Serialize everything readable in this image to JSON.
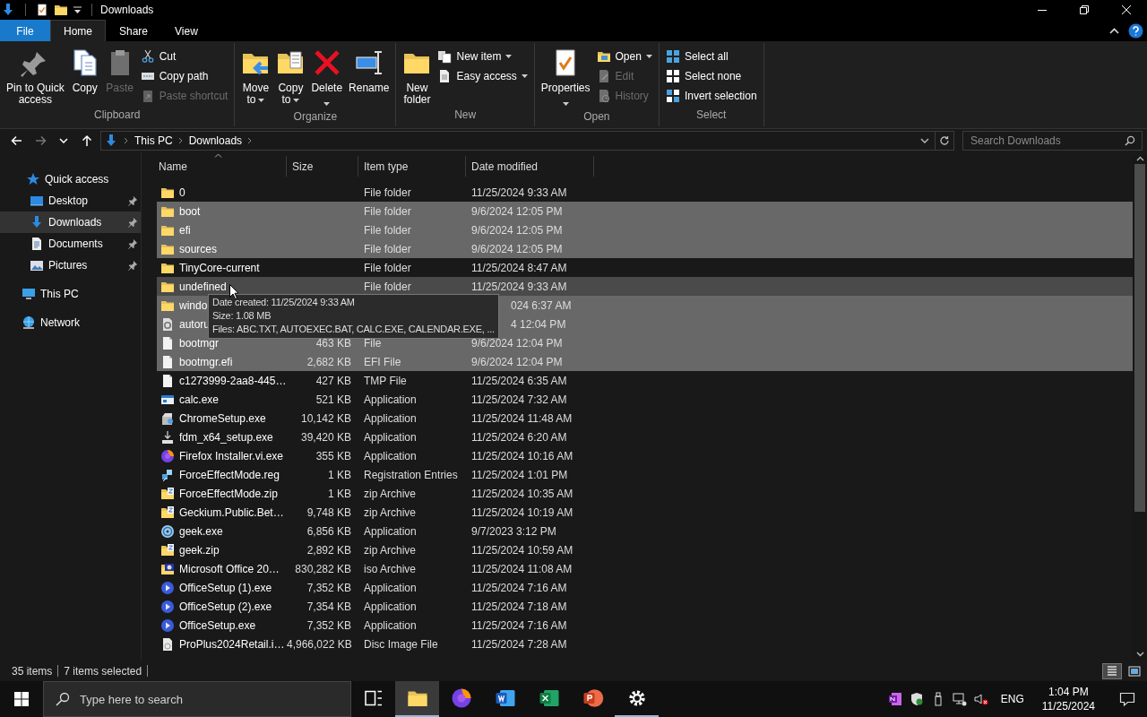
{
  "window": {
    "title": "Downloads"
  },
  "ribbon_tabs": [
    {
      "label": "File",
      "kind": "menu",
      "selected": false
    },
    {
      "label": "Home",
      "kind": "tab",
      "selected": true
    },
    {
      "label": "Share",
      "kind": "tab",
      "selected": false
    },
    {
      "label": "View",
      "kind": "tab",
      "selected": false
    }
  ],
  "ribbon": {
    "groups": [
      {
        "label": "Clipboard",
        "large": [
          {
            "lines": [
              "Pin to Quick",
              "access"
            ],
            "kind": "pin",
            "disabled": false,
            "dropdown": false
          },
          {
            "lines": [
              "Copy"
            ],
            "kind": "copy",
            "disabled": false,
            "dropdown": false
          },
          {
            "lines": [
              "Paste"
            ],
            "kind": "paste",
            "disabled": true,
            "dropdown": false
          }
        ],
        "small": [
          {
            "label": "Cut",
            "kind": "scissors",
            "disabled": false,
            "dropdown": false
          },
          {
            "label": "Copy path",
            "kind": "copypath",
            "disabled": false,
            "dropdown": false
          },
          {
            "label": "Paste shortcut",
            "kind": "pasteshortcut",
            "disabled": true,
            "dropdown": false
          }
        ]
      },
      {
        "label": "Organize",
        "large": [
          {
            "lines": [
              "Move",
              "to"
            ],
            "kind": "moveto",
            "disabled": false,
            "dropdown": true
          },
          {
            "lines": [
              "Copy",
              "to"
            ],
            "kind": "copyto",
            "disabled": false,
            "dropdown": true
          },
          {
            "lines": [
              "Delete"
            ],
            "kind": "delete",
            "disabled": false,
            "dropdown": true
          },
          {
            "lines": [
              "Rename"
            ],
            "kind": "rename",
            "disabled": false,
            "dropdown": false
          }
        ]
      },
      {
        "label": "New",
        "large": [
          {
            "lines": [
              "New",
              "folder"
            ],
            "kind": "folder",
            "disabled": false,
            "dropdown": false
          }
        ],
        "small": [
          {
            "label": "New item",
            "kind": "newitem",
            "disabled": false,
            "dropdown": true
          },
          {
            "label": "Easy access",
            "kind": "easyaccess",
            "disabled": false,
            "dropdown": true
          }
        ]
      },
      {
        "label": "Open",
        "large": [
          {
            "lines": [
              "Properties"
            ],
            "kind": "properties",
            "disabled": false,
            "dropdown": true
          }
        ],
        "small": [
          {
            "label": "Open",
            "kind": "openfolder",
            "disabled": false,
            "dropdown": true
          },
          {
            "label": "Edit",
            "kind": "edit",
            "disabled": true,
            "dropdown": false
          },
          {
            "label": "History",
            "kind": "history",
            "disabled": true,
            "dropdown": false
          }
        ]
      },
      {
        "label": "Select",
        "small": [
          {
            "label": "Select all",
            "kind": "selall",
            "disabled": false,
            "dropdown": false
          },
          {
            "label": "Select none",
            "kind": "selnone",
            "disabled": false,
            "dropdown": false
          },
          {
            "label": "Invert selection",
            "kind": "selinv",
            "disabled": false,
            "dropdown": false
          }
        ]
      }
    ]
  },
  "address_bar": {
    "buttons": [
      {
        "kind": "back",
        "disabled": false
      },
      {
        "kind": "forward",
        "disabled": true
      },
      {
        "kind": "recent",
        "disabled": false
      },
      {
        "kind": "up",
        "disabled": false
      }
    ],
    "path": [
      "This PC",
      "Downloads"
    ],
    "search_placeholder": "Search Downloads"
  },
  "navigation_pane": {
    "items": [
      {
        "label": "Quick access",
        "kind": "star",
        "selected": false,
        "pinned": false,
        "children": [
          {
            "label": "Desktop",
            "kind": "desktop",
            "selected": false,
            "pinned": true
          },
          {
            "label": "Downloads",
            "kind": "download",
            "selected": true,
            "pinned": true
          },
          {
            "label": "Documents",
            "kind": "documents",
            "selected": false,
            "pinned": true
          },
          {
            "label": "Pictures",
            "kind": "pictures",
            "selected": false,
            "pinned": true
          }
        ]
      },
      {
        "label": "This PC",
        "kind": "pc",
        "selected": false,
        "pinned": false
      },
      {
        "label": "Network",
        "kind": "network",
        "selected": false,
        "pinned": false
      }
    ]
  },
  "file_list": {
    "columns": [
      {
        "label": "Name",
        "sorted": true
      },
      {
        "label": "Size",
        "sorted": false
      },
      {
        "label": "Item type",
        "sorted": false
      },
      {
        "label": "Date modified",
        "sorted": false
      }
    ],
    "rows": [
      {
        "name": "0",
        "type": "File folder",
        "date": "11/25/2024 9:33 AM",
        "kind": "folder",
        "selected": false,
        "hovered": false
      },
      {
        "name": "boot",
        "type": "File folder",
        "date": "9/6/2024 12:05 PM",
        "kind": "folder",
        "selected": true,
        "hovered": false
      },
      {
        "name": "efi",
        "type": "File folder",
        "date": "9/6/2024 12:05 PM",
        "kind": "folder",
        "selected": true,
        "hovered": false
      },
      {
        "name": "sources",
        "type": "File folder",
        "date": "9/6/2024 12:05 PM",
        "kind": "folder",
        "selected": true,
        "hovered": false
      },
      {
        "name": "TinyCore-current",
        "type": "File folder",
        "date": "11/25/2024 8:47 AM",
        "kind": "folder",
        "selected": false,
        "hovered": false
      },
      {
        "name": "undefined",
        "type": "File folder",
        "date": "11/25/2024 9:33 AM",
        "kind": "folder",
        "selected": false,
        "hovered": true
      },
      {
        "name": "windo",
        "date": "024 6:37 AM",
        "kind": "folder",
        "selected": true,
        "hovered": false,
        "covered": true
      },
      {
        "name": "autoru",
        "date": "4 12:04 PM",
        "kind": "geardoc",
        "selected": true,
        "hovered": false,
        "covered": true
      },
      {
        "name": "bootmgr",
        "size": "463 KB",
        "type": "File",
        "date": "9/6/2024 12:04 PM",
        "kind": "doc",
        "selected": true,
        "hovered": false
      },
      {
        "name": "bootmgr.efi",
        "size": "2,682 KB",
        "type": "EFI File",
        "date": "9/6/2024 12:04 PM",
        "kind": "doc",
        "selected": true,
        "hovered": false
      },
      {
        "name": "c1273999-2aa8-445…",
        "size": "427 KB",
        "type": "TMP File",
        "date": "11/25/2024 6:35 AM",
        "kind": "doc",
        "selected": false,
        "hovered": false
      },
      {
        "name": "calc.exe",
        "size": "521 KB",
        "type": "Application",
        "date": "11/25/2024 7:32 AM",
        "kind": "window",
        "selected": false,
        "hovered": false
      },
      {
        "name": "ChromeSetup.exe",
        "size": "10,142 KB",
        "type": "Application",
        "date": "11/25/2024 11:48 AM",
        "kind": "installer",
        "selected": false,
        "hovered": false
      },
      {
        "name": "fdm_x64_setup.exe",
        "size": "39,420 KB",
        "type": "Application",
        "date": "11/25/2024 6:20 AM",
        "kind": "dl",
        "selected": false,
        "hovered": false
      },
      {
        "name": "Firefox Installer.vi.exe",
        "size": "355 KB",
        "type": "Application",
        "date": "11/25/2024 10:16 AM",
        "kind": "browser",
        "selected": false,
        "hovered": false
      },
      {
        "name": "ForceEffectMode.reg",
        "size": "1 KB",
        "type": "Registration Entries",
        "date": "11/25/2024 1:01 PM",
        "kind": "reg",
        "selected": false,
        "hovered": false
      },
      {
        "name": "ForceEffectMode.zip",
        "size": "1 KB",
        "type": "zip Archive",
        "date": "11/25/2024 10:35 AM",
        "kind": "zip",
        "selected": false,
        "hovered": false
      },
      {
        "name": "Geckium.Public.Bet…",
        "size": "9,748 KB",
        "type": "zip Archive",
        "date": "11/25/2024 10:19 AM",
        "kind": "zip",
        "selected": false,
        "hovered": false
      },
      {
        "name": "geek.exe",
        "size": "6,856 KB",
        "type": "Application",
        "date": "9/7/2023 3:12 PM",
        "kind": "disc",
        "selected": false,
        "hovered": false
      },
      {
        "name": "geek.zip",
        "size": "2,892 KB",
        "type": "zip Archive",
        "date": "11/25/2024 10:59 AM",
        "kind": "zip",
        "selected": false,
        "hovered": false
      },
      {
        "name": "Microsoft Office 20…",
        "size": "830,282 KB",
        "type": "iso Archive",
        "date": "11/25/2024 11:08 AM",
        "kind": "iso",
        "selected": false,
        "hovered": false
      },
      {
        "name": "OfficeSetup (1).exe",
        "size": "7,352 KB",
        "type": "Application",
        "date": "11/25/2024 7:16 AM",
        "kind": "office",
        "selected": false,
        "hovered": false
      },
      {
        "name": "OfficeSetup (2).exe",
        "size": "7,354 KB",
        "type": "Application",
        "date": "11/25/2024 7:18 AM",
        "kind": "office",
        "selected": false,
        "hovered": false
      },
      {
        "name": "OfficeSetup.exe",
        "size": "7,352 KB",
        "type": "Application",
        "date": "11/25/2024 7:16 AM",
        "kind": "office",
        "selected": false,
        "hovered": false
      },
      {
        "name": "ProPlus2024Retail.i…",
        "size": "4,966,022 KB",
        "type": "Disc Image File",
        "date": "11/25/2024 7:28 AM",
        "kind": "discfile",
        "selected": false,
        "hovered": false
      }
    ],
    "tooltip": {
      "lines": [
        "Date created: 11/25/2024 9:33 AM",
        "Size: 1.08 MB",
        "Files: ABC.TXT, AUTOEXEC.BAT, CALC.EXE, CALENDAR.EXE, ..."
      ]
    }
  },
  "status_bar": {
    "item_count": "35 items",
    "selection": "7 items selected",
    "views": [
      {
        "kind": "details",
        "selected": true
      },
      {
        "kind": "large_icons",
        "selected": false
      }
    ]
  },
  "taskbar": {
    "search_placeholder": "Type here to search",
    "apps": [
      {
        "kind": "taskview",
        "selected": false,
        "running": false
      },
      {
        "kind": "folder",
        "selected": true,
        "running": true
      },
      {
        "kind": "browser",
        "selected": false,
        "running": false
      },
      {
        "kind": "word",
        "selected": false,
        "running": false
      },
      {
        "kind": "excel",
        "selected": false,
        "running": false
      },
      {
        "kind": "ppt",
        "selected": false,
        "running": false
      },
      {
        "kind": "settings",
        "selected": false,
        "running": true
      }
    ],
    "language": "ENG",
    "time": "1:04 PM",
    "date": "11/25/2024"
  }
}
